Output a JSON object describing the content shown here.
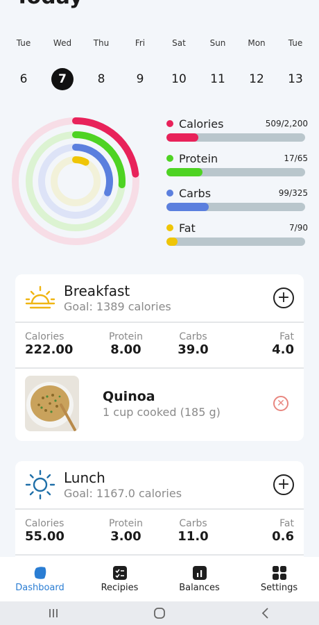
{
  "page_title": "Today",
  "week": {
    "selected_index": 1,
    "days": [
      {
        "name": "Tue",
        "num": "6"
      },
      {
        "name": "Wed",
        "num": "7"
      },
      {
        "name": "Thu",
        "num": "8"
      },
      {
        "name": "Fri",
        "num": "9"
      },
      {
        "name": "Sat",
        "num": "10"
      },
      {
        "name": "Sun",
        "num": "11"
      },
      {
        "name": "Mon",
        "num": "12"
      },
      {
        "name": "Tue",
        "num": "13"
      }
    ]
  },
  "macros": [
    {
      "name": "Calories",
      "value": "509/2,200",
      "fraction": 0.231,
      "color": "#e8225a",
      "track_color": "#f7dde6"
    },
    {
      "name": "Protein",
      "value": "17/65",
      "fraction": 0.262,
      "color": "#4ed323",
      "track_color": "#dcf3d2"
    },
    {
      "name": "Carbs",
      "value": "99/325",
      "fraction": 0.305,
      "color": "#5b7fde",
      "track_color": "#dde3f7"
    },
    {
      "name": "Fat",
      "value": "7/90",
      "fraction": 0.078,
      "color": "#efc506",
      "track_color": "#f2f1d9"
    }
  ],
  "meals": {
    "breakfast": {
      "name": "Breakfast",
      "goal": "Goal: 1389 calories",
      "icon": "sunrise-icon",
      "stats": [
        {
          "label": "Calories",
          "value": "222.00"
        },
        {
          "label": "Protein",
          "value": "8.00"
        },
        {
          "label": "Carbs",
          "value": "39.0"
        },
        {
          "label": "Fat",
          "value": "4.0"
        }
      ],
      "food": {
        "name": "Quinoa",
        "portion": "1 cup cooked (185 g)"
      }
    },
    "lunch": {
      "name": "Lunch",
      "goal": "Goal: 1167.0 calories",
      "icon": "sun-icon",
      "stats": [
        {
          "label": "Calories",
          "value": "55.00"
        },
        {
          "label": "Protein",
          "value": "3.00"
        },
        {
          "label": "Carbs",
          "value": "11.0"
        },
        {
          "label": "Fat",
          "value": "0.6"
        }
      ]
    }
  },
  "nav": [
    {
      "label": "Dashboard",
      "icon": "dashboard-icon",
      "active": true
    },
    {
      "label": "Recipies",
      "icon": "recipes-icon",
      "active": false
    },
    {
      "label": "Balances",
      "icon": "balances-icon",
      "active": false
    },
    {
      "label": "Settings",
      "icon": "settings-icon",
      "active": false
    }
  ],
  "colors": {
    "accent": "#2a7dd3",
    "remove": "#e8867f"
  }
}
